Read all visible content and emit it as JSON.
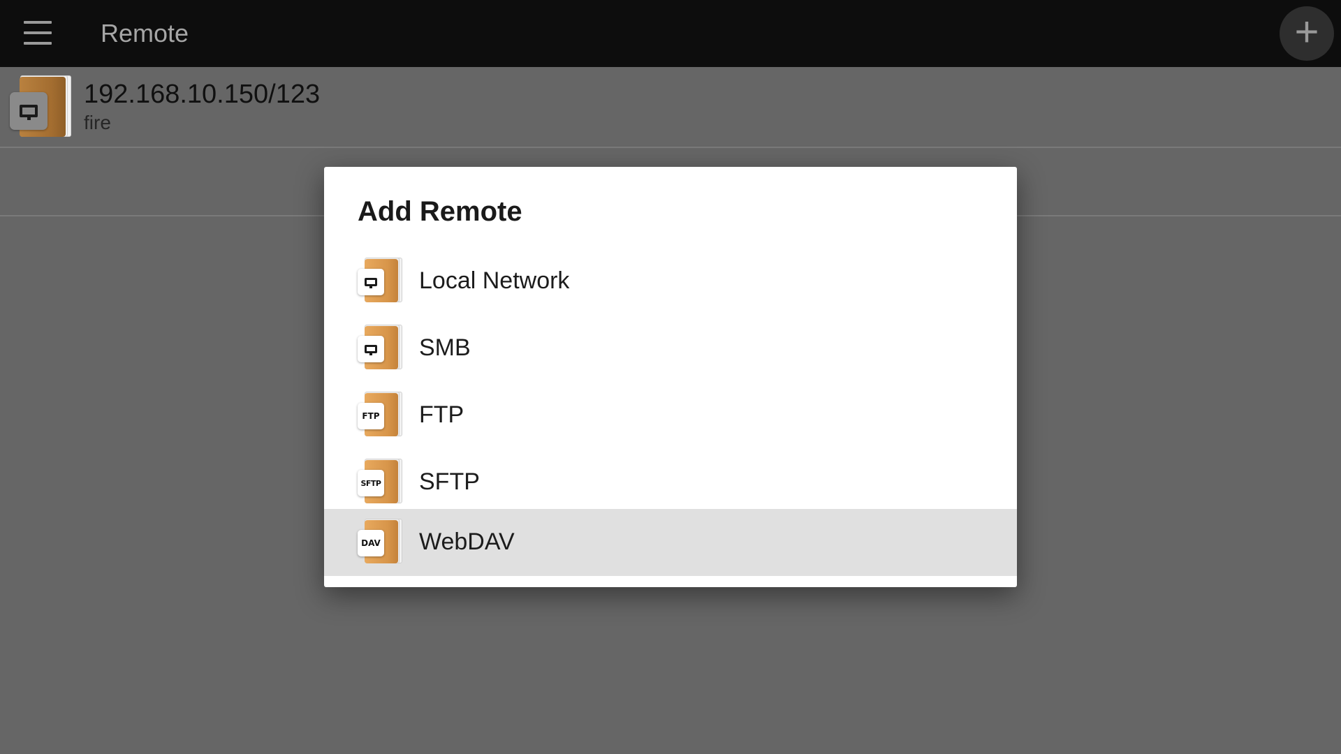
{
  "topbar": {
    "title": "Remote",
    "add_icon": "plus-icon",
    "menu_icon": "hamburger-icon"
  },
  "remotes": [
    {
      "host": "192.168.10.150/123",
      "name": "fire",
      "icon": "monitor-icon"
    }
  ],
  "dialog": {
    "title": "Add Remote",
    "options": [
      {
        "label": "Local Network",
        "badge": "",
        "icon": "monitor-icon"
      },
      {
        "label": "SMB",
        "badge": "",
        "icon": "monitor-icon"
      },
      {
        "label": "FTP",
        "badge": "FTP",
        "icon": "ftp-icon"
      },
      {
        "label": "SFTP",
        "badge": "SFTP",
        "icon": "sftp-icon"
      },
      {
        "label": "WebDAV",
        "badge": "DAV",
        "icon": "webdav-icon",
        "selected": true
      }
    ]
  },
  "colors": {
    "topbar": "#0d0d0d",
    "background": "#666666",
    "folder": "#e0a356",
    "selected_row": "#e0e0e0"
  }
}
